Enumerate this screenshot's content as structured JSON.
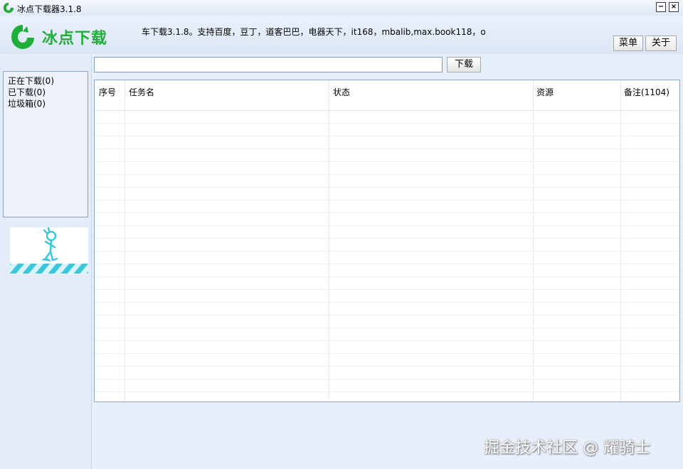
{
  "window": {
    "title": "冰点下载器3.1.8",
    "minimize_symbol": "−",
    "close_symbol": "×"
  },
  "header": {
    "logo_text": "冰点下载",
    "notice": "车下载3.1.8。支持百度，豆丁，道客巴巴，电器天下，it168，mbalib,max.book118，o",
    "menu_label": "菜单",
    "about_label": "关于"
  },
  "search": {
    "value": "",
    "placeholder": "",
    "button_label": "下载"
  },
  "sidebar": {
    "items": [
      {
        "label": "正在下载(0)"
      },
      {
        "label": "已下载(0)"
      },
      {
        "label": "垃圾箱(0)"
      }
    ]
  },
  "table": {
    "columns": [
      "序号",
      "任务名",
      "状态",
      "资源",
      "备注(1104)"
    ],
    "rows": []
  },
  "watermark": "掘金技术社区 @ 耀骑士",
  "colors": {
    "brand_green": "#1fae3a",
    "accent_blue": "#8aa5c6",
    "mascot_cyan": "#3cc7dc"
  },
  "icons": [
    "app-logo-icon",
    "minimize-icon",
    "close-icon",
    "mascot-image"
  ]
}
